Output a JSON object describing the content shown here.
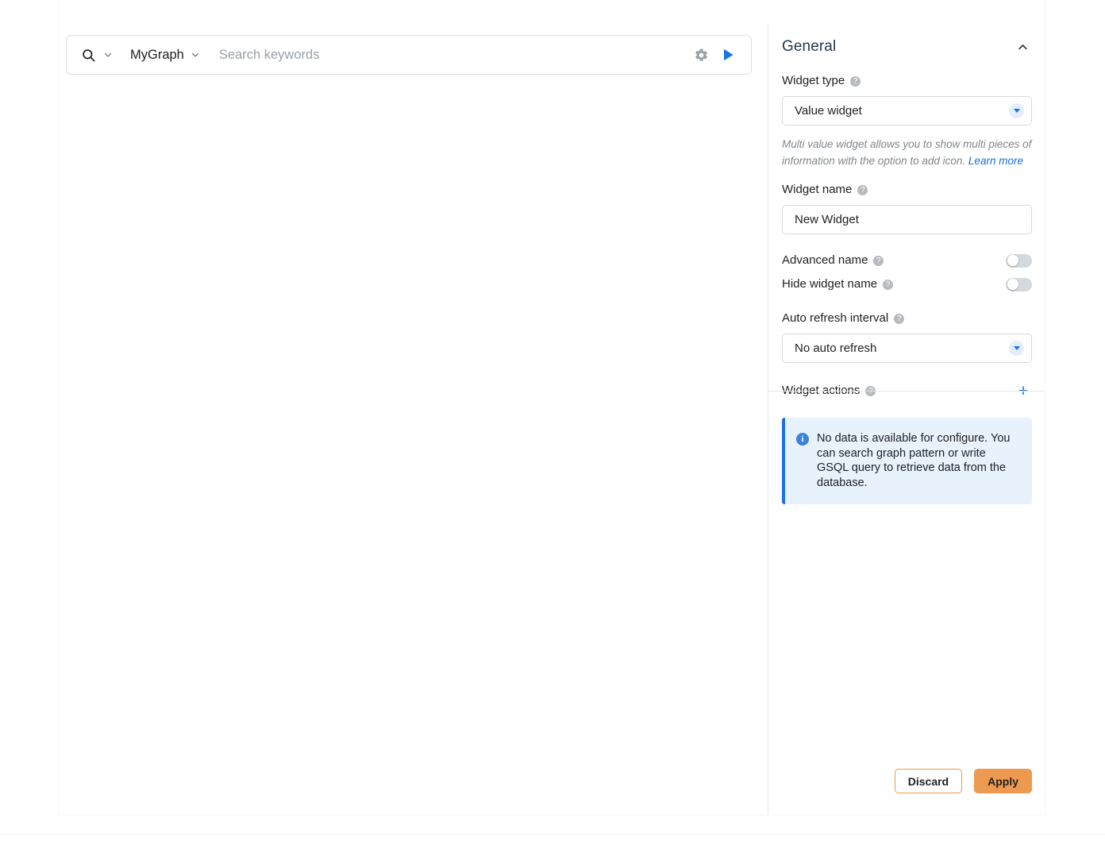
{
  "search": {
    "search_icon": "search-icon",
    "graph_selector_label": "MyGraph",
    "keywords_value": "",
    "keywords_placeholder": "Search keywords",
    "settings_icon": "gear-icon",
    "run_icon": "play-icon"
  },
  "panel": {
    "title": "General",
    "collapse_icon": "chevron-up-icon",
    "widget_type": {
      "label": "Widget type",
      "help": "?",
      "value": "Value widget",
      "options": [
        "Value widget"
      ]
    },
    "hint": {
      "text": "Multi value widget allows you to show multi pieces of information with the option to add icon.",
      "link": "Learn more"
    },
    "widget_name": {
      "label": "Widget name",
      "help": "?",
      "value": "New Widget",
      "placeholder": "Widget name"
    },
    "advanced_name": {
      "label": "Advanced name",
      "help": "?",
      "state": "off"
    },
    "hide_widget_name": {
      "label": "Hide widget name",
      "help": "?",
      "state": "off"
    },
    "auto_refresh": {
      "label": "Auto refresh interval",
      "help": "?",
      "value": "No auto refresh",
      "options": [
        "No auto refresh"
      ]
    },
    "widget_actions": {
      "label": "Widget actions",
      "help": "?",
      "add_icon": "plus-icon"
    }
  },
  "banner": {
    "icon": "info-icon",
    "text": "No data is available for configure. You can search graph pattern or write GSQL query to retrieve data from the database."
  },
  "footer": {
    "discard_label": "Discard",
    "apply_label": "Apply"
  },
  "colors": {
    "accent_blue": "#1a73e8",
    "panel_title": "#25374f",
    "apply_orange": "#ed9a50",
    "banner_bg": "#e7f2fd"
  }
}
